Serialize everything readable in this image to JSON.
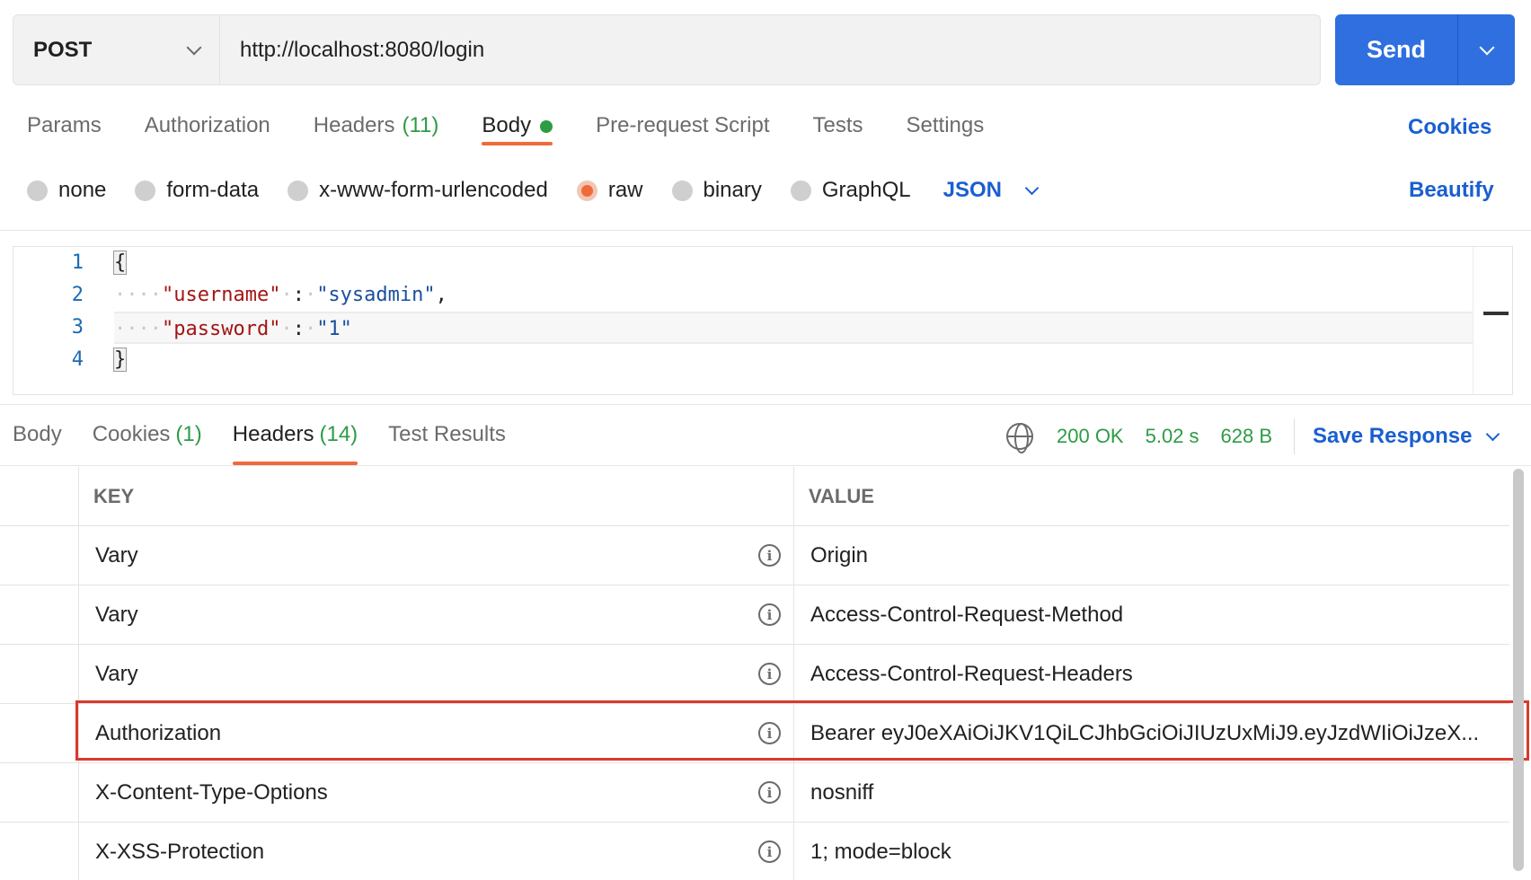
{
  "request": {
    "method": "POST",
    "url": "http://localhost:8080/login",
    "send_label": "Send"
  },
  "req_tabs": {
    "params": "Params",
    "authorization": "Authorization",
    "headers": "Headers",
    "headers_count": "(11)",
    "body": "Body",
    "prerequest": "Pre-request Script",
    "tests": "Tests",
    "settings": "Settings",
    "cookies": "Cookies"
  },
  "body_types": {
    "none": "none",
    "form_data": "form-data",
    "urlencoded": "x-www-form-urlencoded",
    "raw": "raw",
    "binary": "binary",
    "graphql": "GraphQL",
    "language": "JSON",
    "beautify": "Beautify",
    "selected": "raw"
  },
  "editor": {
    "line_numbers": [
      "1",
      "2",
      "3",
      "4"
    ],
    "open_brace": "{",
    "close_brace": "}",
    "username_key": "\"username\"",
    "username_value": "\"sysadmin\"",
    "password_key": "\"password\"",
    "password_value": "\"1\""
  },
  "response": {
    "tabs": {
      "body": "Body",
      "cookies": "Cookies",
      "cookies_count": "(1)",
      "headers": "Headers",
      "headers_count": "(14)",
      "test_results": "Test Results"
    },
    "status": "200 OK",
    "time": "5.02 s",
    "size": "628 B",
    "save_response": "Save Response"
  },
  "headers_table": {
    "key_header": "KEY",
    "value_header": "VALUE",
    "rows": [
      {
        "key": "Vary",
        "value": "Origin"
      },
      {
        "key": "Vary",
        "value": "Access-Control-Request-Method"
      },
      {
        "key": "Vary",
        "value": "Access-Control-Request-Headers"
      },
      {
        "key": "Authorization",
        "value": "Bearer eyJ0eXAiOiJKV1QiLCJhbGciOiJIUzUxMiJ9.eyJzdWIiOiJzeX..."
      },
      {
        "key": "X-Content-Type-Options",
        "value": "nosniff"
      },
      {
        "key": "X-XSS-Protection",
        "value": "1; mode=block"
      }
    ]
  },
  "colors": {
    "accent": "#ef6b3a",
    "primary": "#2f6fe0",
    "success": "#2e9b45",
    "highlight": "#d93a2b"
  }
}
